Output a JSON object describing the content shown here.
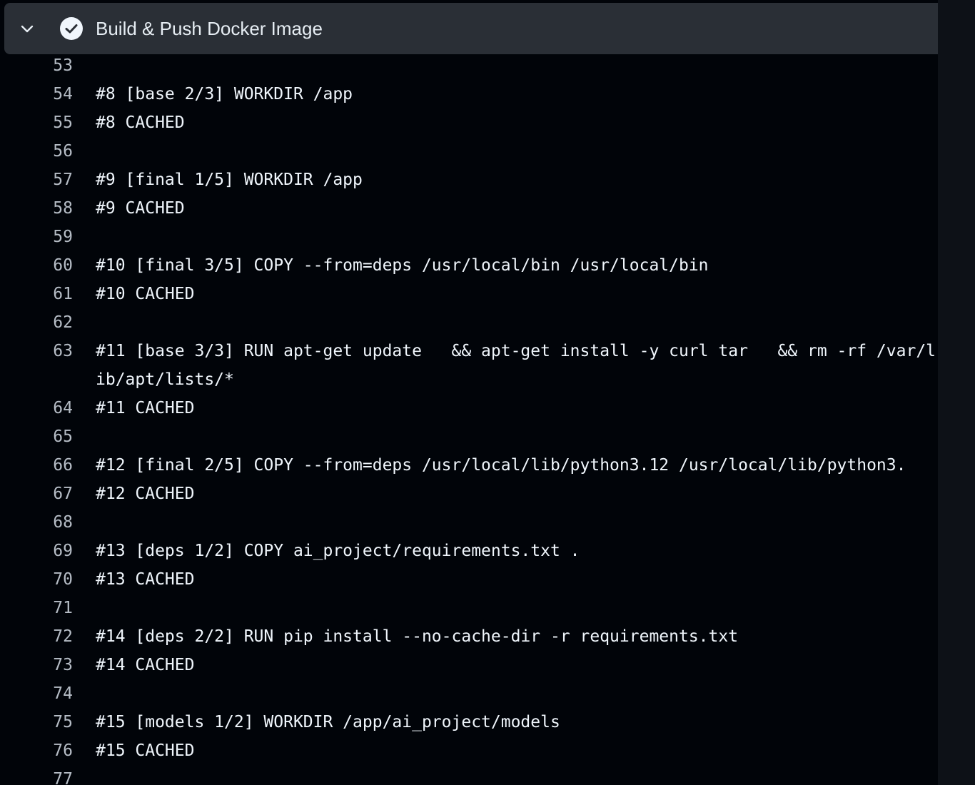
{
  "step": {
    "title": "Build & Push Docker Image",
    "status": "success",
    "expand_icon": "chevron-down-icon",
    "status_icon": "check-circle-icon"
  },
  "colors": {
    "background": "#010409",
    "header_bg": "#2a2f36",
    "text": "#f0f6fc",
    "line_number": "#b6bdc6"
  },
  "log": [
    {
      "n": "53",
      "text": ""
    },
    {
      "n": "54",
      "text": "#8 [base 2/3] WORKDIR /app"
    },
    {
      "n": "55",
      "text": "#8 CACHED"
    },
    {
      "n": "56",
      "text": ""
    },
    {
      "n": "57",
      "text": "#9 [final 1/5] WORKDIR /app"
    },
    {
      "n": "58",
      "text": "#9 CACHED"
    },
    {
      "n": "59",
      "text": ""
    },
    {
      "n": "60",
      "text": "#10 [final 3/5] COPY --from=deps /usr/local/bin /usr/local/bin"
    },
    {
      "n": "61",
      "text": "#10 CACHED"
    },
    {
      "n": "62",
      "text": ""
    },
    {
      "n": "63",
      "text": "#11 [base 3/3] RUN apt-get update   && apt-get install -y curl tar   && rm -rf /var/lib/apt/lists/*"
    },
    {
      "n": "64",
      "text": "#11 CACHED"
    },
    {
      "n": "65",
      "text": ""
    },
    {
      "n": "66",
      "text": "#12 [final 2/5] COPY --from=deps /usr/local/lib/python3.12 /usr/local/lib/python3."
    },
    {
      "n": "67",
      "text": "#12 CACHED"
    },
    {
      "n": "68",
      "text": ""
    },
    {
      "n": "69",
      "text": "#13 [deps 1/2] COPY ai_project/requirements.txt ."
    },
    {
      "n": "70",
      "text": "#13 CACHED"
    },
    {
      "n": "71",
      "text": ""
    },
    {
      "n": "72",
      "text": "#14 [deps 2/2] RUN pip install --no-cache-dir -r requirements.txt"
    },
    {
      "n": "73",
      "text": "#14 CACHED"
    },
    {
      "n": "74",
      "text": ""
    },
    {
      "n": "75",
      "text": "#15 [models 1/2] WORKDIR /app/ai_project/models"
    },
    {
      "n": "76",
      "text": "#15 CACHED"
    },
    {
      "n": "77",
      "text": ""
    }
  ]
}
